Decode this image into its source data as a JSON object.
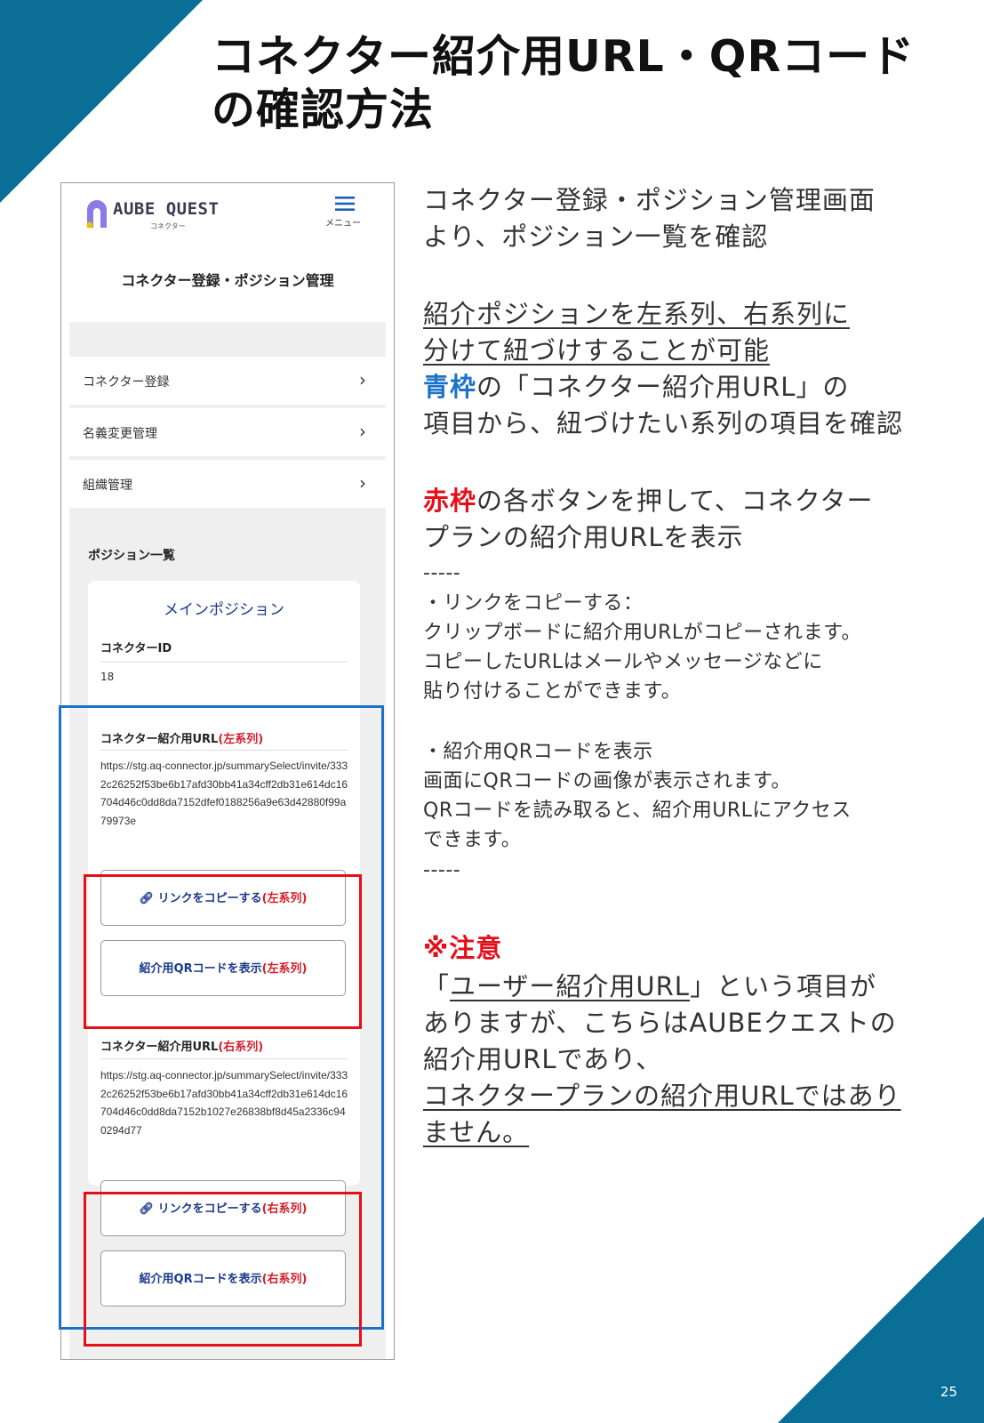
{
  "slide": {
    "title_line1": "コネクター紹介用URL・QRコード",
    "title_line2": "の確認方法",
    "page_number": "25",
    "accent_color": "#0a6e96"
  },
  "app": {
    "logo_text": "AUBE QUEST",
    "logo_sub": "コネクター",
    "menu_label": "メニュー",
    "screen_title": "コネクター登録・ポジション管理",
    "menu_items": [
      {
        "label": "コネクター登録"
      },
      {
        "label": "名義変更管理"
      },
      {
        "label": "組織管理"
      }
    ],
    "positions_heading": "ポジション一覧",
    "card": {
      "title": "メインポジション",
      "connector_id_label": "コネクターID",
      "connector_id_value": "18",
      "left": {
        "label_prefix": "コネクター紹介用URL",
        "label_series": "(左系列)",
        "url": "https://stg.aq-connector.jp/summarySelect/invite/3332c26252f53be6b17afd30bb41a34cff2db31e614dc16704d46c0dd8da7152dfef0188256a9e63d42880f99a79973e",
        "copy_button": "リンクをコピーする",
        "copy_series": "(左系列)",
        "qr_button": "紹介用QRコードを表示",
        "qr_series": "(左系列)"
      },
      "right": {
        "label_prefix": "コネクター紹介用URL",
        "label_series": "(右系列)",
        "url": "https://stg.aq-connector.jp/summarySelect/invite/3332c26252f53be6b17afd30bb41a34cff2db31e614dc16704d46c0dd8da7152b1027e26838bf8d45a2336c940294d77",
        "copy_button": "リンクをコピーする",
        "copy_series": "(右系列)",
        "qr_button": "紹介用QRコードを表示",
        "qr_series": "(右系列)"
      }
    },
    "frame_colors": {
      "blue": "#1a73c8",
      "red": "#e3101a"
    }
  },
  "instructions": {
    "p1_line1": "コネクター登録・ポジション管理画面",
    "p1_line2": "より、ポジション一覧を確認",
    "p2_line1": "紹介ポジションを左系列、右系列に",
    "p2_line2": "分けて紐づけすることが可能",
    "p2_line3_strong": "青枠",
    "p2_line3_rest": "の「コネクター紹介用URL」の",
    "p2_line4": "項目から、紐づけたい系列の項目を確認",
    "p3_line1_strong": "赤枠",
    "p3_line1_rest": "の各ボタンを押して、コネクター",
    "p3_line2": "プランの紹介用URLを表示",
    "divider": "-----",
    "b1_title": "・リンクをコピーする：",
    "b1_line1": "クリップボードに紹介用URLがコピーされます。",
    "b1_line2": "コピーしたURLはメールやメッセージなどに",
    "b1_line3": "貼り付けることができます。",
    "b2_title": "・紹介用QRコードを表示",
    "b2_line1": "画面にQRコードの画像が表示されます。",
    "b2_line2": "QRコードを読み取ると、紹介用URLにアクセス",
    "b2_line3": "できます。",
    "note_title": "※注意",
    "note_l1_open": "「",
    "note_l1_u": "ユーザー紹介用URL",
    "note_l1_rest": "」という項目が",
    "note_l2": "ありますが、こちらはAUBEクエストの",
    "note_l3": "紹介用URLであり、",
    "note_l4": "コネクタープランの紹介用URLではあり",
    "note_l5": "ません。"
  }
}
